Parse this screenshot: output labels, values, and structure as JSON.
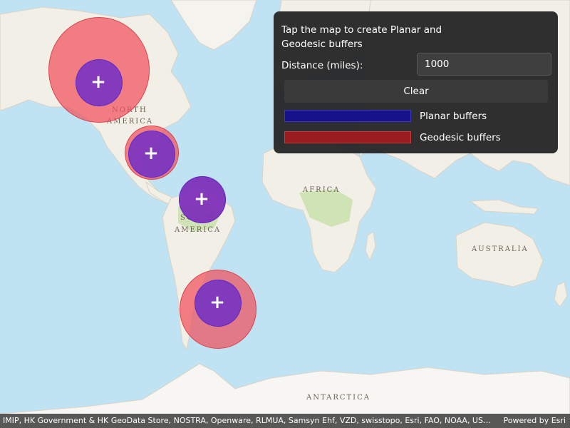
{
  "map": {
    "labels": {
      "north_america_1": "NORTH",
      "north_america_2": "AMERICA",
      "south_america_1": "SOUTH",
      "south_america_2": "AMERICA",
      "africa": "AFRICA",
      "australia": "AUSTRALIA",
      "antarctica": "ANTARCTICA"
    },
    "marker_glyph": "+",
    "colors": {
      "ocean": "#bfe3f3",
      "land": "#f2efe6",
      "vegetation": "#cfe3b4",
      "geodesic_fill": "#f0505c",
      "planar_fill": "#6c2cc8"
    }
  },
  "panel": {
    "instructions": "Tap the map to create Planar and Geodesic buffers",
    "distance_label": "Distance (miles):",
    "distance_value": "1000",
    "clear_label": "Clear",
    "legend": {
      "planar_label": "Planar buffers",
      "planar_color": "#16128a",
      "geodesic_label": "Geodesic buffers",
      "geodesic_color": "#9a1c1e"
    }
  },
  "attribution": {
    "text": "IMIP, HK Government & HK GeoData Store, NOSTRA, Openware, RLMUA, Samsyn Ehf, VZD, swisstopo, Esri, FAO, NOAA, USGS, NR...",
    "powered_by": "Powered by Esri"
  }
}
